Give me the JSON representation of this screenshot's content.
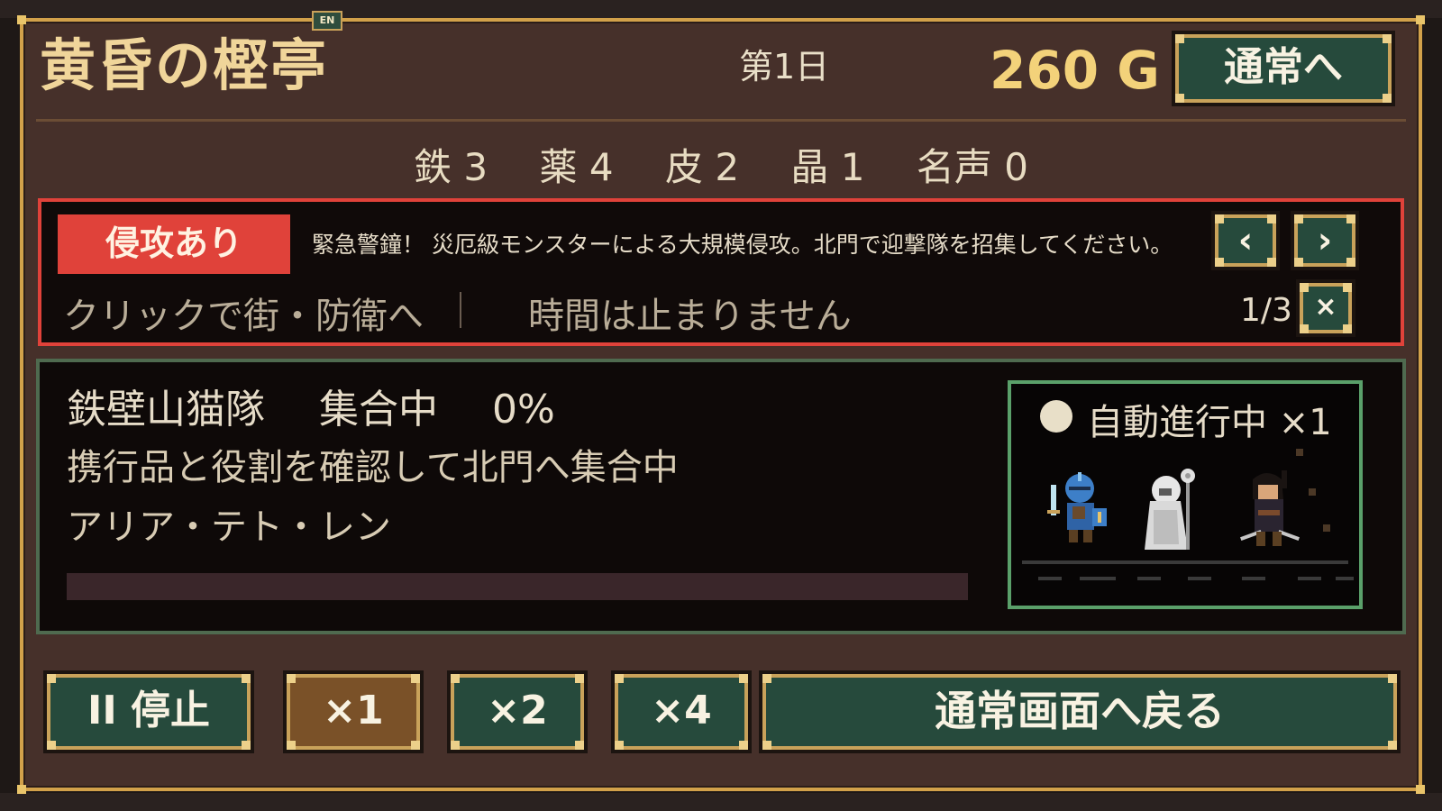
{
  "header": {
    "lang_badge": "EN",
    "title": "黄昏の樫亭",
    "day": "第1日",
    "gold": "260 G",
    "normal_button": "通常へ"
  },
  "resources": [
    {
      "name": "鉄",
      "value": "3"
    },
    {
      "name": "薬",
      "value": "4"
    },
    {
      "name": "皮",
      "value": "2"
    },
    {
      "name": "晶",
      "value": "1"
    },
    {
      "name": "名声",
      "value": "0"
    }
  ],
  "alert": {
    "tag": "侵攻あり",
    "message": "緊急警鐘！ 災厄級モンスターによる大規模侵攻。北門で迎撃隊を招集してください。",
    "hint": "クリックで街・防衛へ",
    "time_note": "時間は止まりません",
    "page": "1/3",
    "prev_icon": "‹",
    "next_icon": "›",
    "close_icon": "×",
    "accent_color": "#e0423a"
  },
  "party": {
    "name": "鉄壁山猫隊",
    "status": "集合中",
    "progress_text": "0%",
    "progress": 0,
    "description": "携行品と役割を確認して北門へ集合中",
    "members": "アリア・テト・レン",
    "viewer_label": "自動進行中 ×1",
    "sprites": [
      "knight-sprite",
      "cleric-sprite",
      "rogue-sprite"
    ]
  },
  "controls": {
    "pause": "II 停止",
    "speed_x1": "×1",
    "speed_x2": "×2",
    "speed_x4": "×4",
    "return": "通常画面へ戻る"
  }
}
